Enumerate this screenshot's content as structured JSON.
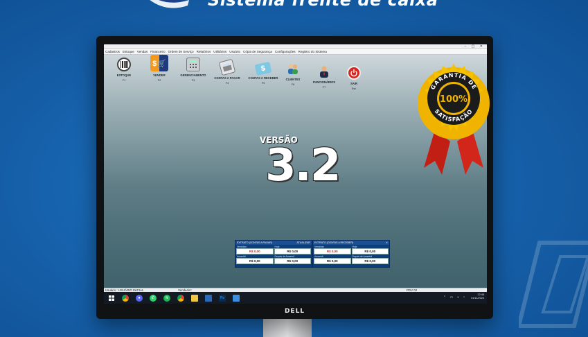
{
  "headline": "Sistema frente de caixa",
  "app": {
    "menu": [
      "Cadastros",
      "Estoque",
      "Vendas",
      "Financeiro",
      "Ordem de Serviço",
      "Relatórios",
      "Utilitários",
      "Usuário",
      "Cópia de Segurança",
      "Configurações",
      "Registro do Sistema"
    ],
    "tools": [
      {
        "label": "ESTOQUE",
        "key": "F1",
        "icon": "barcode-icon"
      },
      {
        "label": "VENDER",
        "key": "F2",
        "icon": "cart-icon"
      },
      {
        "label": "GERENCIAMENTO",
        "key": "F3",
        "icon": "calculator-icon"
      },
      {
        "label": "CONTAS A PAGAR",
        "key": "F4",
        "icon": "cash-register-icon"
      },
      {
        "label": "CONTAS A RECEBER",
        "key": "F5",
        "icon": "money-icon"
      },
      {
        "label": "CLIENTES",
        "key": "F6",
        "icon": "users-icon"
      },
      {
        "label": "FUNCIONÁRIOS",
        "key": "F7",
        "icon": "employee-icon"
      },
      {
        "label": "SAIR",
        "key": "Esc",
        "icon": "power-icon"
      }
    ],
    "version_label": "VERSÃO",
    "version_number": "3.2",
    "panel_pagar": {
      "title": "EXTRATO (CONTAS A PAGAR)",
      "action": "ATUALIZAR",
      "vencidas_label": "Vencidas",
      "vencidas_value": "R$ 0,00",
      "hoje_label": "Hoje",
      "hoje_value": "R$ 0,00",
      "amanha_label": "Amanhã",
      "amanha_value": "R$ 0,00",
      "depois_label": "Depois de Amanhã",
      "depois_value": "R$ 0,00"
    },
    "panel_receber": {
      "title": "EXTRATO (CONTAS A RECEBER)",
      "vencidas_label": "Vencidas",
      "vencidas_value": "R$ 0,00",
      "hoje_label": "Hoje",
      "hoje_value": "R$ 0,00",
      "amanha_label": "Amanhã",
      "amanha_value": "R$ 0,00",
      "depois_label": "Depois de Amanhã",
      "depois_value": "R$ 0,00"
    },
    "status": {
      "user": "Usuário : USUÁRIO INICIAL",
      "seller": "Vendedor:",
      "pdv": "PDV 02"
    },
    "taskbar": {
      "time": "22:48",
      "date": "01/11/2020"
    }
  },
  "monitor_brand": "DELL",
  "seal": {
    "top_text": "GARANTIA DE",
    "center": "100%",
    "bottom_text": "SATISFAÇÃO"
  },
  "colors": {
    "accent": "#1763ad",
    "panel": "#0d3d7a",
    "seal_gold": "#f0b400",
    "ribbon": "#d2261a"
  }
}
